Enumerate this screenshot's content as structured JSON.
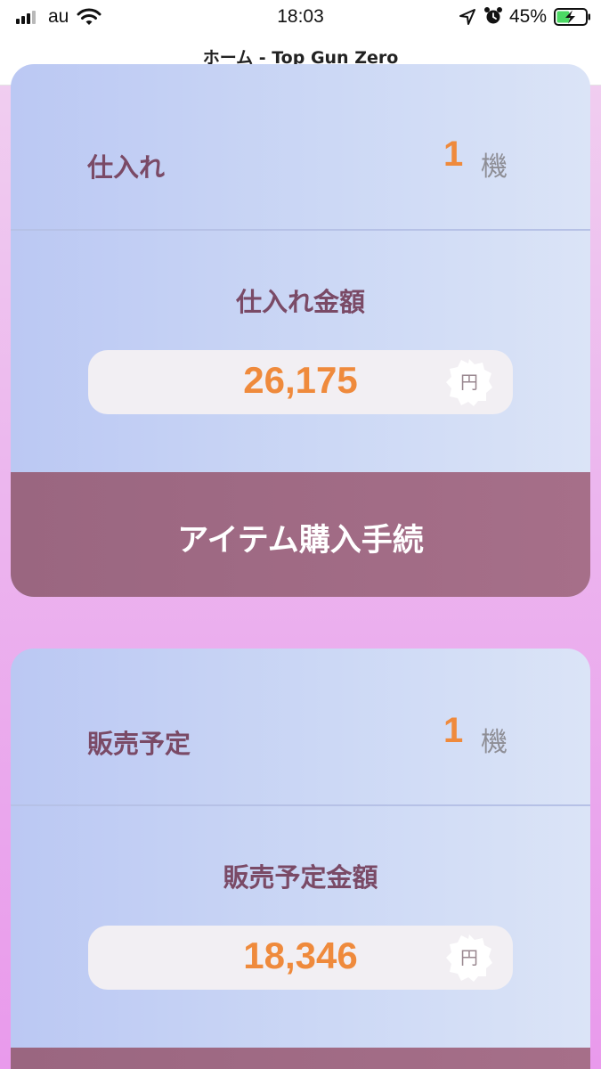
{
  "status_bar": {
    "carrier": "au",
    "time": "18:03",
    "battery_percent": "45%",
    "battery_level": 0.45
  },
  "header": {
    "title": "ホーム - Top Gun Zero"
  },
  "purchase_card": {
    "label": "仕入れ",
    "quantity": "1",
    "unit": "機",
    "amount_label": "仕入れ金額",
    "amount": "26,175",
    "currency": "円",
    "action_label": "アイテム購入手続"
  },
  "sale_card": {
    "label": "販売予定",
    "quantity": "1",
    "unit": "機",
    "amount_label": "販売予定金額",
    "amount": "18,346",
    "currency": "円"
  },
  "colors": {
    "accent_orange": "#ef8a3c",
    "label_purple": "#7a4a66",
    "action_mauve": "#9a6680",
    "card_blue": "#bbc8f3"
  },
  "icons": [
    "signal-icon",
    "wifi-icon",
    "location-icon",
    "alarm-icon",
    "battery-icon",
    "yen-badge-icon"
  ]
}
